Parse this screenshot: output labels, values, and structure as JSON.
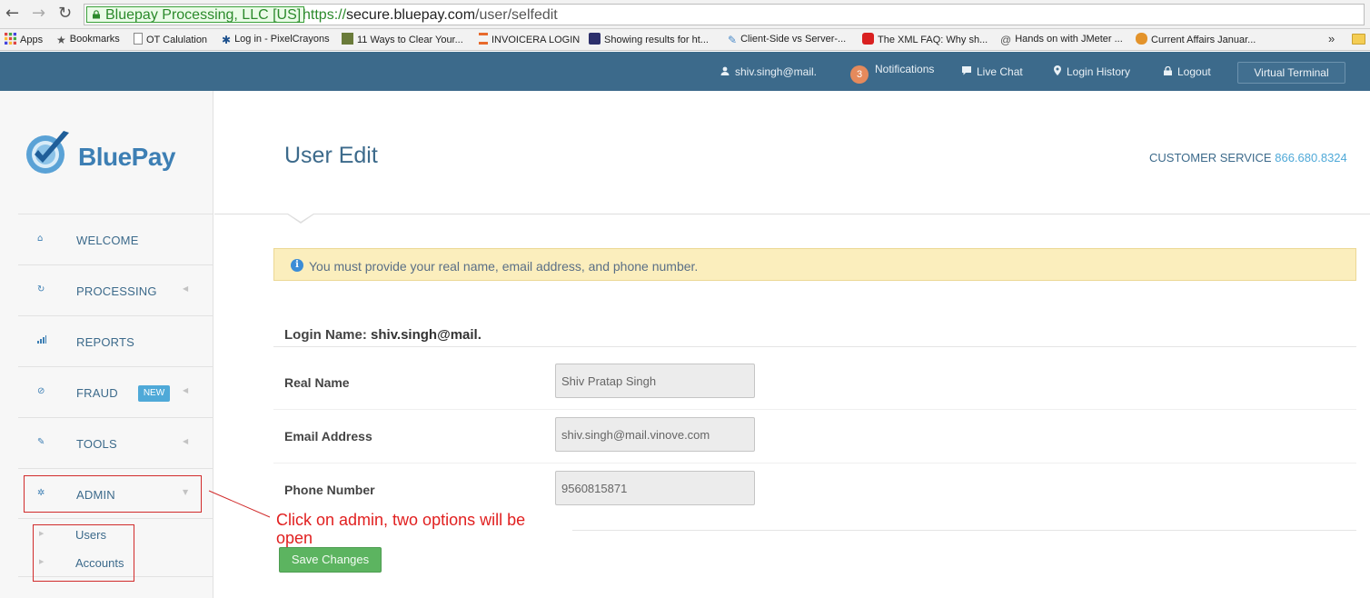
{
  "browser": {
    "ev_label": "Bluepay Processing, LLC [US]",
    "url_scheme": "https://",
    "url_host": "secure.bluepay.com",
    "url_path": "/user/selfedit",
    "bookmarks": [
      {
        "label": "Apps"
      },
      {
        "label": "Bookmarks"
      },
      {
        "label": "OT Calulation"
      },
      {
        "label": "Log in - PixelCrayons"
      },
      {
        "label": "11 Ways to Clear Your..."
      },
      {
        "label": "INVOICERA LOGIN"
      },
      {
        "label": "Showing results for ht..."
      },
      {
        "label": "Client-Side vs Server-..."
      },
      {
        "label": "The XML FAQ: Why sh..."
      },
      {
        "label": "Hands on with JMeter ..."
      },
      {
        "label": "Current Affairs Januar..."
      }
    ],
    "more": "»"
  },
  "topbar": {
    "user": "shiv.singh@mail.",
    "notifications_count": "3",
    "notifications_label": "Notifications",
    "live_chat": "Live Chat",
    "login_history": "Login History",
    "logout": "Logout",
    "virtual_terminal": "Virtual Terminal"
  },
  "sidebar": {
    "logo_text": "BluePay",
    "items": [
      {
        "label": "WELCOME",
        "icon": "home-icon"
      },
      {
        "label": "PROCESSING",
        "icon": "refresh-icon"
      },
      {
        "label": "REPORTS",
        "icon": "bar-chart-icon"
      },
      {
        "label": "FRAUD",
        "icon": "ban-icon",
        "badge": "NEW"
      },
      {
        "label": "TOOLS",
        "icon": "wrench-icon"
      },
      {
        "label": "ADMIN",
        "icon": "gear-icon"
      }
    ],
    "admin_subitems": [
      {
        "label": "Users"
      },
      {
        "label": "Accounts"
      }
    ]
  },
  "main": {
    "title": "User Edit",
    "customer_service_label": "CUSTOMER SERVICE",
    "customer_service_phone": "866.680.8324",
    "alert": "You must provide your real name, email address, and phone number.",
    "login_name_label": "Login Name:",
    "login_name_value": "shiv.singh@mail.",
    "fields": [
      {
        "label": "Real Name",
        "value": "Shiv Pratap Singh"
      },
      {
        "label": "Email Address",
        "value": "shiv.singh@mail.vinove.com"
      },
      {
        "label": "Phone Number",
        "value": "9560815871"
      }
    ],
    "save_button": "Save Changes"
  },
  "annotation": {
    "text": "Click on admin, two options will be open"
  },
  "colors": {
    "topbar": "#3c6a8b",
    "accent": "#4fa9d8",
    "alert_bg": "#fbeebd",
    "save_button": "#5cb460",
    "annotation": "#e12020"
  }
}
